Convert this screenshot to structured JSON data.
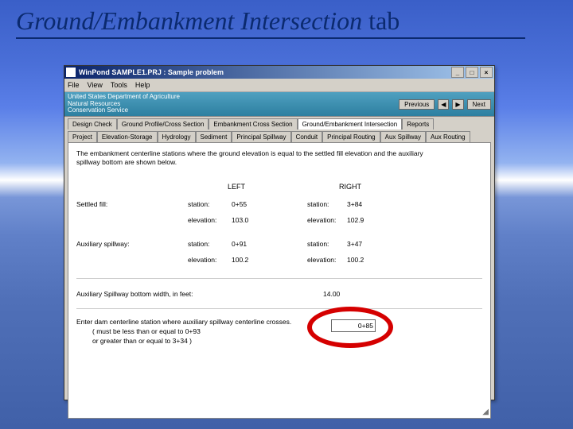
{
  "slide": {
    "title_italic": "Ground/Embankment Intersection",
    "title_plain": "  tab"
  },
  "window": {
    "title": "WinPond   SAMPLE1.PRJ : Sample problem",
    "minimize": "_",
    "maximize": "□",
    "close": "×"
  },
  "menubar": {
    "file": "File",
    "view": "View",
    "tools": "Tools",
    "help": "Help"
  },
  "banner": {
    "line1": "United States Department of Agriculture",
    "line2": "Natural Resources",
    "line3": "Conservation Service",
    "previous": "Previous",
    "next": "Next",
    "left_arrow": "◀",
    "right_arrow": "▶"
  },
  "tabs_main": {
    "t1": "Design Check",
    "t2": "Ground Profile/Cross Section",
    "t3": "Embankment Cross Section",
    "t4": "Ground/Embankment Intersection",
    "t5": "Reports"
  },
  "tabs_sub": {
    "s1": "Project",
    "s2": "Elevation-Storage",
    "s3": "Hydrology",
    "s4": "Sediment",
    "s5": "Principal Spillway",
    "s6": "Conduit",
    "s7": "Principal Routing",
    "s8": "Aux Spillway",
    "s9": "Aux Routing"
  },
  "content": {
    "desc": "The embankment centerline stations where the ground elevation is equal to the settled fill elevation and the auxiliary spillway bottom are shown below.",
    "left_header": "LEFT",
    "right_header": "RIGHT",
    "row_settled": "Settled fill:",
    "row_aux": "Auxiliary spillway:",
    "label_station": "station:",
    "label_elevation": "elevation:",
    "settled": {
      "left_station": "0+55",
      "left_elev": "103.0",
      "right_station": "3+84",
      "right_elev": "102.9"
    },
    "aux": {
      "left_station": "0+91",
      "left_elev": "100.2",
      "right_station": "3+47",
      "right_elev": "100.2"
    },
    "bottom_width_label": "Auxiliary Spillway bottom width, in feet:",
    "bottom_width_value": "14.00",
    "control_line1": "Enter dam centerline station where auxiliary spillway centerline crosses.",
    "control_line2": "( must be less than or equal to 0+93",
    "control_line3": "  or greater than or equal to 3+34 )",
    "control_input": "0+85"
  }
}
